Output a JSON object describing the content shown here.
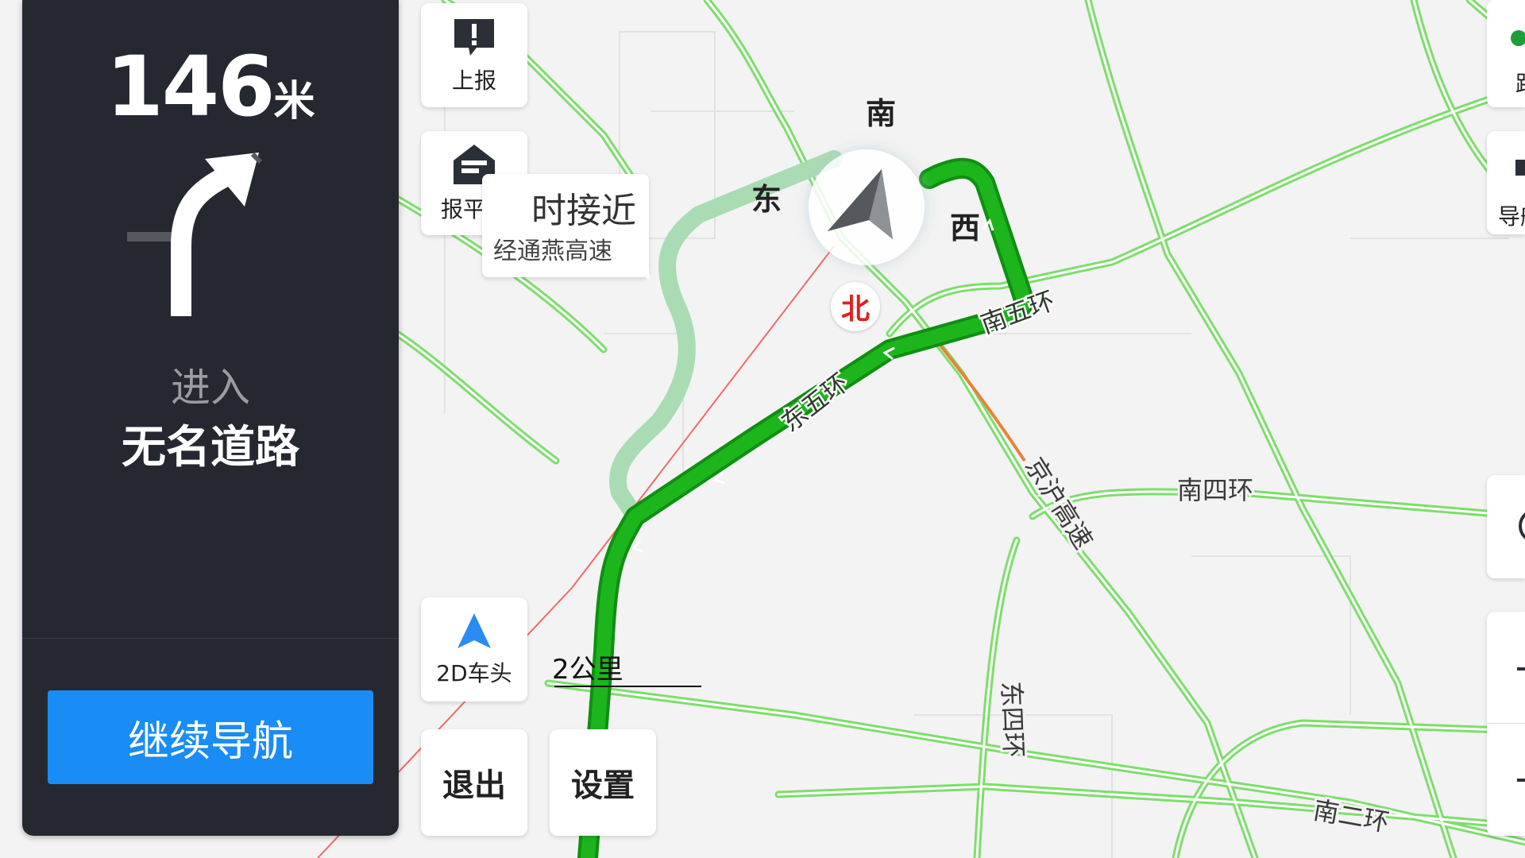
{
  "guidance": {
    "distance_value": "146",
    "distance_unit": "米",
    "action": "进入",
    "road_name": "无名道路",
    "continue_label": "继续导航"
  },
  "toolbar": {
    "report_label": "上报",
    "safety_label": "报平安",
    "view_mode_label": "2D车头",
    "exit_label": "退出",
    "settings_label": "设置"
  },
  "callout": {
    "title": "时接近",
    "subtitle": "经通燕高速"
  },
  "compass": {
    "south": "南",
    "east": "东",
    "west": "西",
    "north": "北"
  },
  "scale": {
    "label": "2公里"
  },
  "map_labels": {
    "s5": "南五环",
    "e5": "东五环",
    "jinghu": "京沪高速",
    "s4": "南四环",
    "e4": "东四环",
    "s2": "南二环"
  },
  "right_edge": {
    "top_label": "路",
    "nav_label": "导航"
  },
  "colors": {
    "panel_bg": "#252830",
    "route_green": "#14a814",
    "road_green": "#7dde6b",
    "primary_blue": "#1a8cf5",
    "north_red": "#e02020"
  }
}
